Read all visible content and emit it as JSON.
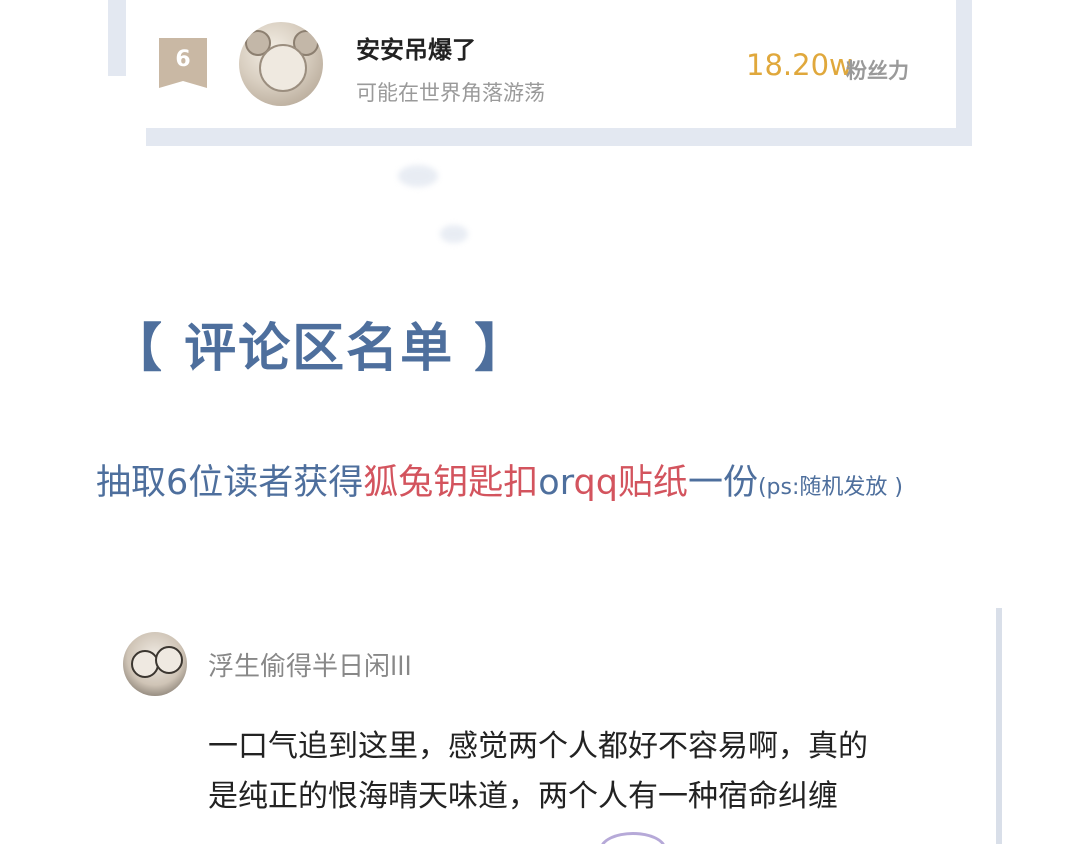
{
  "ranking": {
    "rank": "6",
    "name": "安安吊爆了",
    "description": "可能在世界角落游荡",
    "fan_power_value": "18.20w",
    "fan_power_label": "粉丝力"
  },
  "section": {
    "title": "【 评论区名单 】"
  },
  "giveaway": {
    "part1": "抽取6位读者获得",
    "prize1": "狐兔钥匙扣",
    "connector": "or",
    "prize2": "qq贴纸",
    "part2": "一份",
    "note": "(ps:随机发放 )"
  },
  "comment": {
    "username": "浮生偷得半日闲lll",
    "line1": "一口气追到这里，感觉两个人都好不容易啊，真的",
    "line2": "是纯正的恨海晴天味道，两个人有一种宿命纠缠"
  },
  "colors": {
    "heading_blue": "#4e6f9d",
    "prize_red": "#d3545e",
    "fan_power_gold": "#e0a83c",
    "badge_tan": "#c9b8a4",
    "card_border": "#e3e8f1"
  },
  "icons": {
    "rank_badge": "ribbon-badge-icon",
    "rank_avatar": "user-avatar",
    "comment_avatar": "user-avatar"
  }
}
